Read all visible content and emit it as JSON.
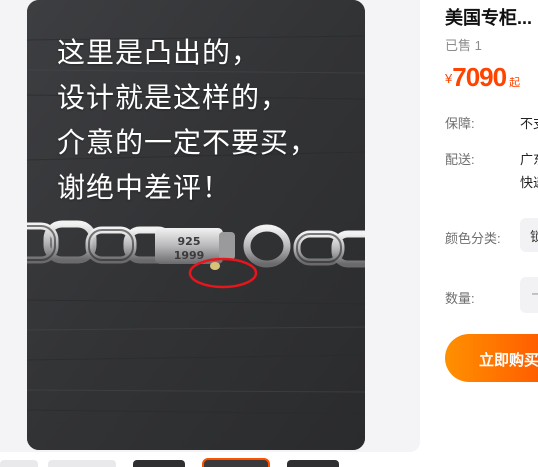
{
  "gallery": {
    "overlay_lines": [
      "这里是凸出的，",
      "设计就是这样的，",
      "介意的一定不要买，",
      "谢绝中差评！"
    ],
    "stamp_text_1": "925",
    "stamp_text_2": "1999"
  },
  "product": {
    "title": "美国专柜...",
    "sold": "已售 1",
    "price_currency": "¥",
    "price_value": "7090",
    "price_suffix": "起"
  },
  "details": {
    "guarantee_label": "保障:",
    "guarantee_value": "不支",
    "shipping_label": "配送:",
    "shipping_value_1": "广东",
    "shipping_value_2": "快递",
    "color_label": "颜色分类:",
    "color_value": "锁",
    "quantity_label": "数量:",
    "quantity_minus": "—"
  },
  "actions": {
    "buy_now": "立即购买"
  },
  "colors": {
    "accent": "#ff5000",
    "price": "#ff4400",
    "highlight_circle": "#e8151b"
  }
}
